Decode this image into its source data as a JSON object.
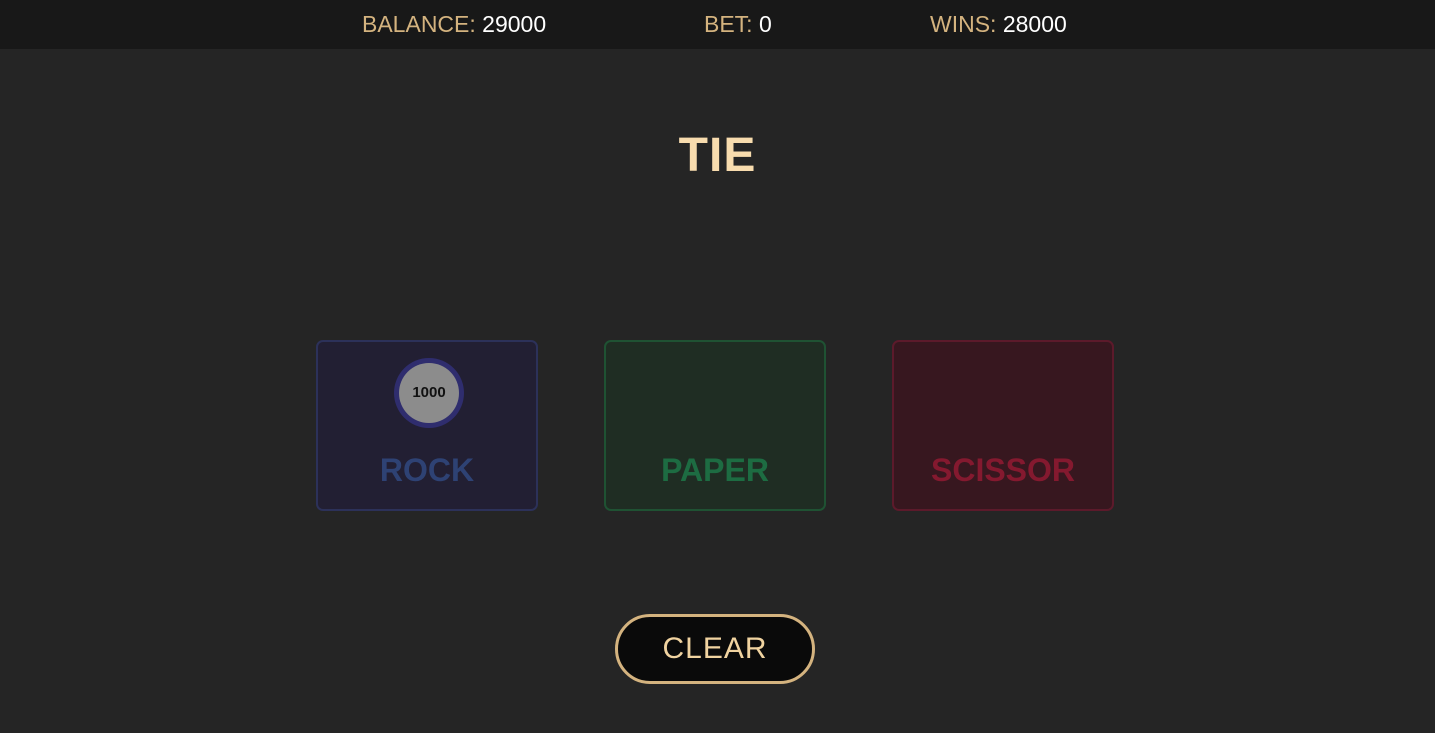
{
  "header": {
    "balance": {
      "label": "BALANCE:",
      "value": "29000"
    },
    "bet": {
      "label": "BET:",
      "value": "0"
    },
    "wins": {
      "label": "WINS:",
      "value": "28000"
    }
  },
  "result": "TIE",
  "choices": [
    {
      "label": "ROCK",
      "chip": "1000"
    },
    {
      "label": "PAPER"
    },
    {
      "label": "SCISSOR"
    }
  ],
  "clear_label": "CLEAR",
  "colors": {
    "accent": "#d4b37f",
    "result_text": "#f8dcae",
    "rock": "#2e4274",
    "paper": "#1d6c42",
    "scissor": "#84192f"
  }
}
